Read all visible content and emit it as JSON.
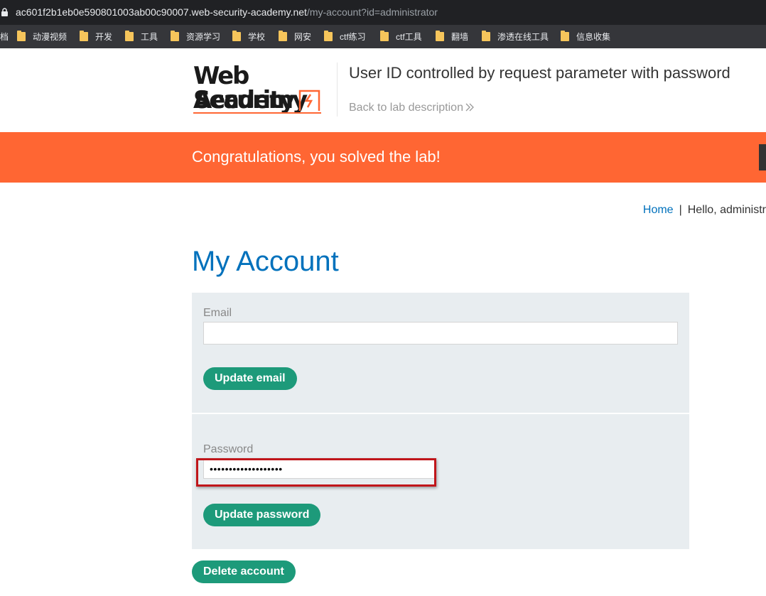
{
  "browser": {
    "url_host": "ac601f2b1eb0e590801003ab00c90007.web-security-academy.net",
    "url_path": "/my-account?id=administrator",
    "bookmarks": [
      {
        "label": "档"
      },
      {
        "label": "动漫视频"
      },
      {
        "label": "开发"
      },
      {
        "label": "工具"
      },
      {
        "label": "资源学习"
      },
      {
        "label": "学校"
      },
      {
        "label": "网安"
      },
      {
        "label": "ctf练习"
      },
      {
        "label": "ctf工具"
      },
      {
        "label": "翻墙"
      },
      {
        "label": "渗透在线工具"
      },
      {
        "label": "信息收集"
      }
    ]
  },
  "header": {
    "logo_line1": "Web Security",
    "logo_line2": "Academy",
    "lab_title": "User ID controlled by request parameter with password",
    "back_link": "Back to lab description"
  },
  "banner": {
    "message": "Congratulations, you solved the lab!"
  },
  "nav": {
    "home": "Home",
    "separator": "|",
    "greeting": "Hello, administr"
  },
  "main": {
    "title": "My Account",
    "email_label": "Email",
    "email_value": "",
    "update_email_label": "Update email",
    "password_label": "Password",
    "password_value": "•••••••••••••••••••",
    "update_password_label": "Update password",
    "delete_account_label": "Delete account"
  },
  "colors": {
    "accent_orange": "#ff6633",
    "link_blue": "#0071bc",
    "button_green": "#1d9a7a",
    "highlight_red": "#c0161b"
  }
}
